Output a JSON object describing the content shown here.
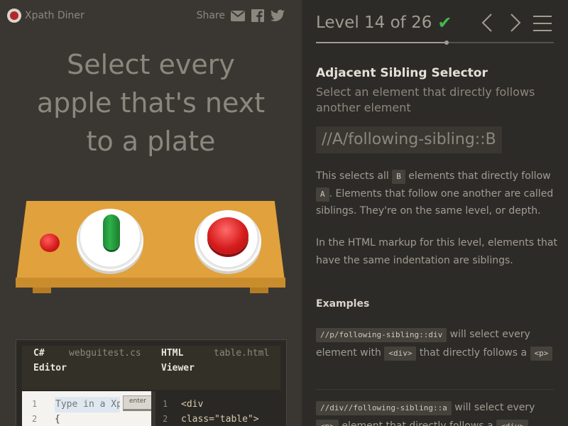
{
  "app": {
    "name": "Xpath Diner"
  },
  "share": {
    "label": "Share",
    "icons": [
      "mail-icon",
      "facebook-icon",
      "twitter-icon"
    ]
  },
  "instruction": {
    "line1": "Select every",
    "line2": "apple that's next",
    "line3": "to a plate"
  },
  "editor": {
    "left_title_1": "C#",
    "left_title_2": "Editor",
    "left_file": "webguitest.cs",
    "right_title_1": "HTML",
    "right_title_2": "Viewer",
    "right_file": "table.html",
    "left_lines": [
      "1",
      "2"
    ],
    "input_placeholder": "Type in a Xpath",
    "brace": "{",
    "enter_label": "enter",
    "right_lines": [
      "1",
      "2"
    ],
    "html_line1": "<div",
    "html_line2": "class=\"table\">"
  },
  "level": {
    "label": "Level 14 of 26",
    "completed": true,
    "progress_fraction": 0.54
  },
  "lesson": {
    "heading": "Adjacent Sibling Selector",
    "subheading": "Select an element that directly follows another element",
    "syntax": "//A/following-sibling::B",
    "p1_a": "This selects all",
    "chip_b": "B",
    "p1_b": "elements that directly follow",
    "chip_a": "A",
    "p1_c": ". Elements that follow one another are called siblings. They're on the same level, or depth.",
    "p2": "In the HTML markup for this level, elements that have the same indentation are siblings.",
    "examples_heading": "Examples",
    "ex1_code": "//p/following-sibling::div",
    "ex1_a": "will select every element with",
    "ex1_chip": "<div>",
    "ex1_b": "that directly follows a",
    "ex1_chip2": "<p>",
    "ex2_code": "//div//following-sibling::a",
    "ex2_a": "will select every",
    "ex2_chip": "<p>",
    "ex2_b": "element that directly follows a",
    "ex2_chip2": "<div>"
  },
  "colors": {
    "accent_green": "#3fb950",
    "table": "#e1a13c",
    "apple": "#d61c1c",
    "pickle": "#2fb14a"
  }
}
